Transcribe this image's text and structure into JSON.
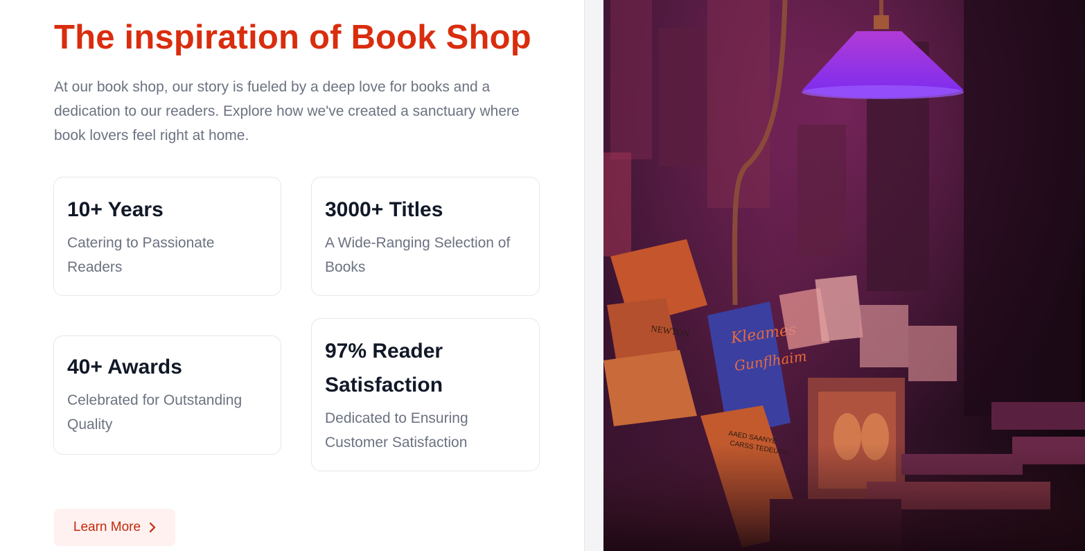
{
  "section": {
    "title": "The inspiration of Book Shop",
    "intro": "At our book shop, our story is fueled by a deep love for books and a dedication to our readers. Explore how we've created a sanctuary where book lovers feel right at home."
  },
  "stats": [
    {
      "title": "10+ Years",
      "description": "Catering to Passionate Readers"
    },
    {
      "title": "3000+ Titles",
      "description": "A Wide-Ranging Selection of Books"
    },
    {
      "title": "40+ Awards",
      "description": "Celebrated for Outstanding Quality"
    },
    {
      "title": "97% Reader Satisfaction",
      "description": "Dedicated to Ensuring Customer Satisfaction"
    }
  ],
  "cta": {
    "label": "Learn More",
    "icon": "chevron-right-icon"
  },
  "image": {
    "book_text_1": "NEWTON",
    "book_text_2": "Kleames",
    "book_text_3": "Gunflhaim",
    "book_text_4": "AAED SAANYE",
    "book_text_5": "CARSS TEDEUTN"
  },
  "colors": {
    "accent": "#d92d0e",
    "button_bg": "#fef1ef",
    "heading": "#111827",
    "muted": "#6b7280"
  }
}
